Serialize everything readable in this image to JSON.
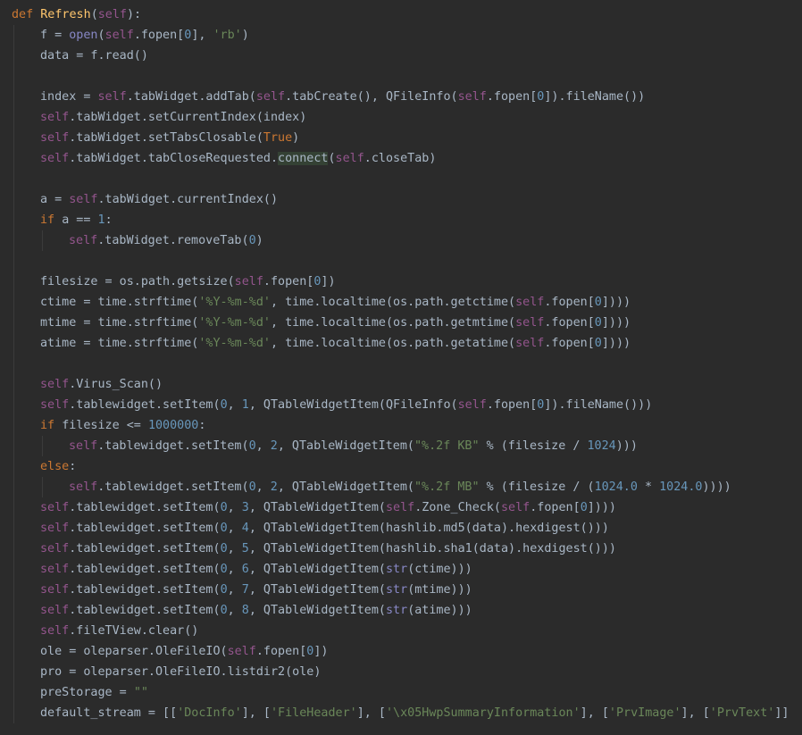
{
  "editor": {
    "theme": "darcula",
    "colors": {
      "background": "#2b2b2b",
      "plain": "#a9b7c6",
      "keyword": "#cc7832",
      "function_def": "#ffc66d",
      "self": "#94558d",
      "string": "#6a8759",
      "number": "#6897bb",
      "builtin": "#8888c6",
      "highlight": "#344134"
    },
    "lines": [
      {
        "indent": 0,
        "tokens": [
          [
            "kw",
            "def "
          ],
          [
            "fn",
            "Refresh"
          ],
          [
            "plain",
            "("
          ],
          [
            "self",
            "self"
          ],
          [
            "plain",
            "):"
          ]
        ]
      },
      {
        "indent": 1,
        "tokens": [
          [
            "plain",
            "f = "
          ],
          [
            "builtin",
            "open"
          ],
          [
            "plain",
            "("
          ],
          [
            "self",
            "self"
          ],
          [
            "plain",
            ".fopen["
          ],
          [
            "num",
            "0"
          ],
          [
            "plain",
            "], "
          ],
          [
            "str",
            "'rb'"
          ],
          [
            "plain",
            ")"
          ]
        ]
      },
      {
        "indent": 1,
        "tokens": [
          [
            "plain",
            "data = f.read()"
          ]
        ]
      },
      {
        "indent": -1,
        "tokens": []
      },
      {
        "indent": 1,
        "tokens": [
          [
            "plain",
            "index = "
          ],
          [
            "self",
            "self"
          ],
          [
            "plain",
            ".tabWidget.addTab("
          ],
          [
            "self",
            "self"
          ],
          [
            "plain",
            ".tabCreate(), QFileInfo("
          ],
          [
            "self",
            "self"
          ],
          [
            "plain",
            ".fopen["
          ],
          [
            "num",
            "0"
          ],
          [
            "plain",
            "]).fileName())"
          ]
        ]
      },
      {
        "indent": 1,
        "tokens": [
          [
            "self",
            "self"
          ],
          [
            "plain",
            ".tabWidget.setCurrentIndex(index)"
          ]
        ]
      },
      {
        "indent": 1,
        "tokens": [
          [
            "self",
            "self"
          ],
          [
            "plain",
            ".tabWidget.setTabsClosable("
          ],
          [
            "kw",
            "True"
          ],
          [
            "plain",
            ")"
          ]
        ]
      },
      {
        "indent": 1,
        "tokens": [
          [
            "self",
            "self"
          ],
          [
            "plain",
            ".tabWidget.tabCloseRequested."
          ],
          [
            "hl",
            "connect"
          ],
          [
            "plain",
            "("
          ],
          [
            "self",
            "self"
          ],
          [
            "plain",
            ".closeTab)"
          ]
        ]
      },
      {
        "indent": -1,
        "tokens": []
      },
      {
        "indent": 1,
        "tokens": [
          [
            "plain",
            "a = "
          ],
          [
            "self",
            "self"
          ],
          [
            "plain",
            ".tabWidget.currentIndex()"
          ]
        ]
      },
      {
        "indent": 1,
        "tokens": [
          [
            "kw",
            "if "
          ],
          [
            "plain",
            "a == "
          ],
          [
            "num",
            "1"
          ],
          [
            "plain",
            ":"
          ]
        ]
      },
      {
        "indent": 2,
        "tokens": [
          [
            "self",
            "self"
          ],
          [
            "plain",
            ".tabWidget.removeTab("
          ],
          [
            "num",
            "0"
          ],
          [
            "plain",
            ")"
          ]
        ]
      },
      {
        "indent": -1,
        "tokens": []
      },
      {
        "indent": 1,
        "tokens": [
          [
            "plain",
            "filesize = os.path.getsize("
          ],
          [
            "self",
            "self"
          ],
          [
            "plain",
            ".fopen["
          ],
          [
            "num",
            "0"
          ],
          [
            "plain",
            "])"
          ]
        ]
      },
      {
        "indent": 1,
        "tokens": [
          [
            "plain",
            "ctime = time.strftime("
          ],
          [
            "str",
            "'%Y-%m-%d'"
          ],
          [
            "plain",
            ", time.localtime(os.path.getctime("
          ],
          [
            "self",
            "self"
          ],
          [
            "plain",
            ".fopen["
          ],
          [
            "num",
            "0"
          ],
          [
            "plain",
            "])))"
          ]
        ]
      },
      {
        "indent": 1,
        "tokens": [
          [
            "plain",
            "mtime = time.strftime("
          ],
          [
            "str",
            "'%Y-%m-%d'"
          ],
          [
            "plain",
            ", time.localtime(os.path.getmtime("
          ],
          [
            "self",
            "self"
          ],
          [
            "plain",
            ".fopen["
          ],
          [
            "num",
            "0"
          ],
          [
            "plain",
            "])))"
          ]
        ]
      },
      {
        "indent": 1,
        "tokens": [
          [
            "plain",
            "atime = time.strftime("
          ],
          [
            "str",
            "'%Y-%m-%d'"
          ],
          [
            "plain",
            ", time.localtime(os.path.getatime("
          ],
          [
            "self",
            "self"
          ],
          [
            "plain",
            ".fopen["
          ],
          [
            "num",
            "0"
          ],
          [
            "plain",
            "])))"
          ]
        ]
      },
      {
        "indent": -1,
        "tokens": []
      },
      {
        "indent": 1,
        "tokens": [
          [
            "self",
            "self"
          ],
          [
            "plain",
            ".Virus_Scan()"
          ]
        ]
      },
      {
        "indent": 1,
        "tokens": [
          [
            "self",
            "self"
          ],
          [
            "plain",
            ".tablewidget.setItem("
          ],
          [
            "num",
            "0"
          ],
          [
            "plain",
            ", "
          ],
          [
            "num",
            "1"
          ],
          [
            "plain",
            ", QTableWidgetItem(QFileInfo("
          ],
          [
            "self",
            "self"
          ],
          [
            "plain",
            ".fopen["
          ],
          [
            "num",
            "0"
          ],
          [
            "plain",
            "]).fileName()))"
          ]
        ]
      },
      {
        "indent": 1,
        "tokens": [
          [
            "kw",
            "if "
          ],
          [
            "plain",
            "filesize <= "
          ],
          [
            "num",
            "1000000"
          ],
          [
            "plain",
            ":"
          ]
        ]
      },
      {
        "indent": 2,
        "tokens": [
          [
            "self",
            "self"
          ],
          [
            "plain",
            ".tablewidget.setItem("
          ],
          [
            "num",
            "0"
          ],
          [
            "plain",
            ", "
          ],
          [
            "num",
            "2"
          ],
          [
            "plain",
            ", QTableWidgetItem("
          ],
          [
            "str",
            "\"%.2f KB\""
          ],
          [
            "plain",
            " % (filesize / "
          ],
          [
            "num",
            "1024"
          ],
          [
            "plain",
            ")))"
          ]
        ]
      },
      {
        "indent": 1,
        "tokens": [
          [
            "kw",
            "else"
          ],
          [
            "plain",
            ":"
          ]
        ]
      },
      {
        "indent": 2,
        "tokens": [
          [
            "self",
            "self"
          ],
          [
            "plain",
            ".tablewidget.setItem("
          ],
          [
            "num",
            "0"
          ],
          [
            "plain",
            ", "
          ],
          [
            "num",
            "2"
          ],
          [
            "plain",
            ", QTableWidgetItem("
          ],
          [
            "str",
            "\"%.2f MB\""
          ],
          [
            "plain",
            " % (filesize / ("
          ],
          [
            "num",
            "1024.0"
          ],
          [
            "plain",
            " * "
          ],
          [
            "num",
            "1024.0"
          ],
          [
            "plain",
            "))))"
          ]
        ]
      },
      {
        "indent": 1,
        "tokens": [
          [
            "self",
            "self"
          ],
          [
            "plain",
            ".tablewidget.setItem("
          ],
          [
            "num",
            "0"
          ],
          [
            "plain",
            ", "
          ],
          [
            "num",
            "3"
          ],
          [
            "plain",
            ", QTableWidgetItem("
          ],
          [
            "self",
            "self"
          ],
          [
            "plain",
            ".Zone_Check("
          ],
          [
            "self",
            "self"
          ],
          [
            "plain",
            ".fopen["
          ],
          [
            "num",
            "0"
          ],
          [
            "plain",
            "])))"
          ]
        ]
      },
      {
        "indent": 1,
        "tokens": [
          [
            "self",
            "self"
          ],
          [
            "plain",
            ".tablewidget.setItem("
          ],
          [
            "num",
            "0"
          ],
          [
            "plain",
            ", "
          ],
          [
            "num",
            "4"
          ],
          [
            "plain",
            ", QTableWidgetItem(hashlib.md5(data).hexdigest()))"
          ]
        ]
      },
      {
        "indent": 1,
        "tokens": [
          [
            "self",
            "self"
          ],
          [
            "plain",
            ".tablewidget.setItem("
          ],
          [
            "num",
            "0"
          ],
          [
            "plain",
            ", "
          ],
          [
            "num",
            "5"
          ],
          [
            "plain",
            ", QTableWidgetItem(hashlib.sha1(data).hexdigest()))"
          ]
        ]
      },
      {
        "indent": 1,
        "tokens": [
          [
            "self",
            "self"
          ],
          [
            "plain",
            ".tablewidget.setItem("
          ],
          [
            "num",
            "0"
          ],
          [
            "plain",
            ", "
          ],
          [
            "num",
            "6"
          ],
          [
            "plain",
            ", QTableWidgetItem("
          ],
          [
            "builtin",
            "str"
          ],
          [
            "plain",
            "(ctime)))"
          ]
        ]
      },
      {
        "indent": 1,
        "tokens": [
          [
            "self",
            "self"
          ],
          [
            "plain",
            ".tablewidget.setItem("
          ],
          [
            "num",
            "0"
          ],
          [
            "plain",
            ", "
          ],
          [
            "num",
            "7"
          ],
          [
            "plain",
            ", QTableWidgetItem("
          ],
          [
            "builtin",
            "str"
          ],
          [
            "plain",
            "(mtime)))"
          ]
        ]
      },
      {
        "indent": 1,
        "tokens": [
          [
            "self",
            "self"
          ],
          [
            "plain",
            ".tablewidget.setItem("
          ],
          [
            "num",
            "0"
          ],
          [
            "plain",
            ", "
          ],
          [
            "num",
            "8"
          ],
          [
            "plain",
            ", QTableWidgetItem("
          ],
          [
            "builtin",
            "str"
          ],
          [
            "plain",
            "(atime)))"
          ]
        ]
      },
      {
        "indent": 1,
        "tokens": [
          [
            "self",
            "self"
          ],
          [
            "plain",
            ".fileTView.clear()"
          ]
        ]
      },
      {
        "indent": 1,
        "tokens": [
          [
            "plain",
            "ole = oleparser.OleFileIO("
          ],
          [
            "self",
            "self"
          ],
          [
            "plain",
            ".fopen["
          ],
          [
            "num",
            "0"
          ],
          [
            "plain",
            "])"
          ]
        ]
      },
      {
        "indent": 1,
        "tokens": [
          [
            "plain",
            "pro = oleparser.OleFileIO.listdir2(ole)"
          ]
        ]
      },
      {
        "indent": 1,
        "tokens": [
          [
            "plain",
            "preStorage = "
          ],
          [
            "str",
            "\"\""
          ]
        ]
      },
      {
        "indent": 1,
        "tokens": [
          [
            "plain",
            "default_stream = [["
          ],
          [
            "str",
            "'DocInfo'"
          ],
          [
            "plain",
            "], ["
          ],
          [
            "str",
            "'FileHeader'"
          ],
          [
            "plain",
            "], ["
          ],
          [
            "str",
            "'\\x05HwpSummaryInformation'"
          ],
          [
            "plain",
            "], ["
          ],
          [
            "str",
            "'PrvImage'"
          ],
          [
            "plain",
            "], ["
          ],
          [
            "str",
            "'PrvText'"
          ],
          [
            "plain",
            "]]"
          ]
        ]
      }
    ]
  }
}
